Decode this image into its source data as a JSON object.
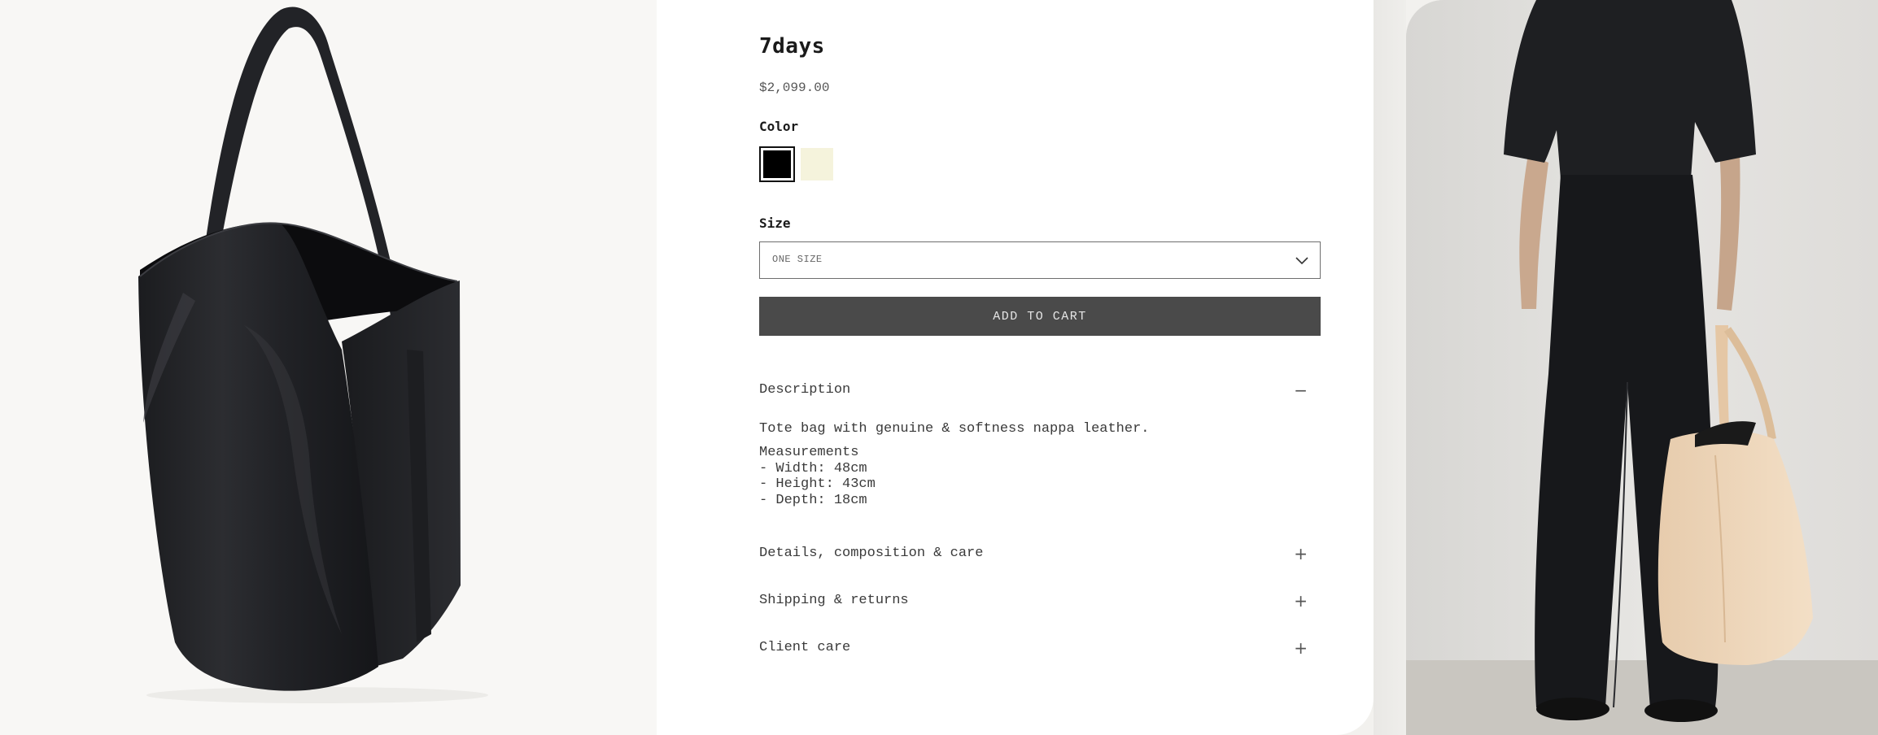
{
  "product": {
    "title": "7days",
    "price": "$2,099.00"
  },
  "color": {
    "label": "Color",
    "swatches": [
      {
        "name": "black",
        "hex": "#000000",
        "selected": true
      },
      {
        "name": "cream",
        "hex": "#f5f3dc",
        "selected": false
      }
    ]
  },
  "size": {
    "label": "Size",
    "selected": "ONE SIZE"
  },
  "cart": {
    "add_label": "ADD TO CART"
  },
  "accordion": {
    "description": {
      "label": "Description",
      "icon": "minus-icon",
      "expanded": true,
      "text": "Tote bag with genuine & softness nappa leather.",
      "measurements": "Measurements\n- Width: 48cm\n- Height: 43cm\n- Depth: 18cm"
    },
    "details": {
      "label": "Details, composition & care",
      "icon": "plus-icon"
    },
    "shipping": {
      "label": "Shipping & returns",
      "icon": "plus-icon"
    },
    "client_care": {
      "label": "Client care",
      "icon": "plus-icon"
    }
  },
  "images": {
    "product_photo": "black-leather-tote-bag",
    "model_photo": "model-in-black-jumpsuit-holding-cream-tote"
  },
  "colors": {
    "button_bg": "#4a4a4a",
    "card_bg": "#ffffff",
    "left_bg": "#f8f7f5"
  },
  "glyphs": {
    "minus": "−",
    "plus": "+"
  }
}
